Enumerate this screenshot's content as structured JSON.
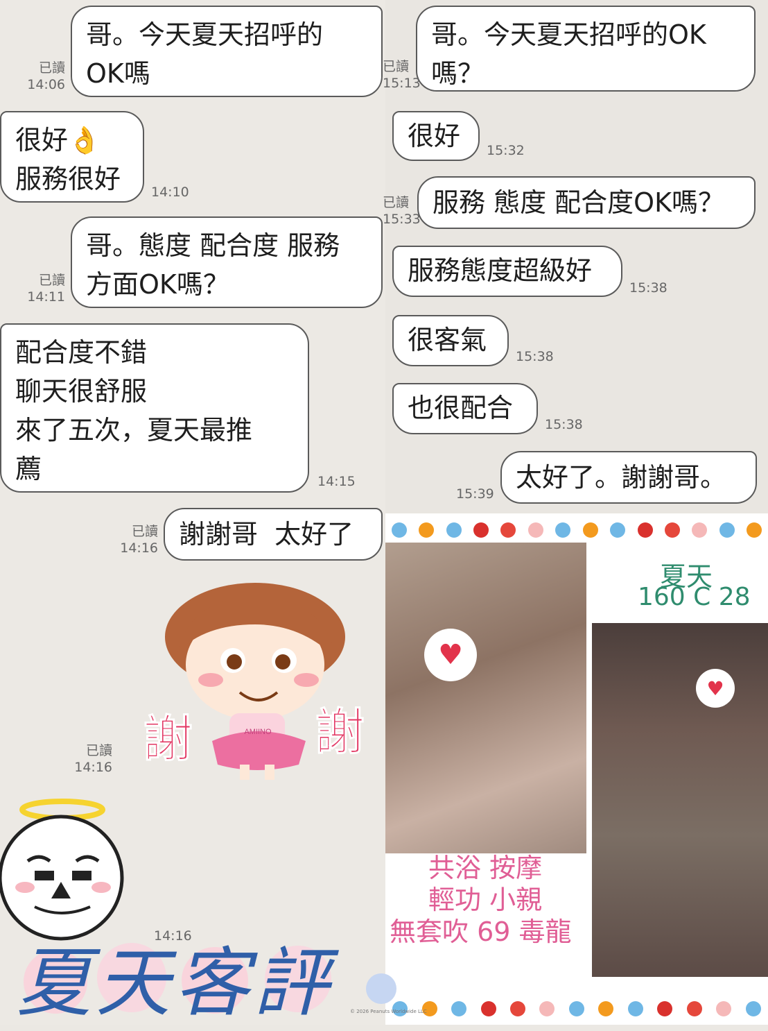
{
  "left_chat": {
    "messages": [
      {
        "side": "me",
        "text": "哥。今天夏天招呼的\nOK嗎",
        "read": "已讀",
        "time": "14:06"
      },
      {
        "side": "peer",
        "text": "很好👌\n服務很好",
        "time": "14:10"
      },
      {
        "side": "me",
        "text": "哥。態度 配合度 服務\n方面OK嗎？",
        "read": "已讀",
        "time": "14:11"
      },
      {
        "side": "peer",
        "text": "配合度不錯\n聊天很舒服\n來了五次，夏天最推\n薦",
        "time": "14:15"
      },
      {
        "side": "me",
        "text": "謝謝哥  太好了",
        "read": "已讀",
        "time": "14:16"
      }
    ],
    "sticker_girl": {
      "read": "已讀",
      "time": "14:16",
      "sign_left": "謝",
      "sign_right": "謝",
      "shirt_text": "AMIINO"
    },
    "sticker_angel": {
      "time": "14:16"
    }
  },
  "right_chat": {
    "messages": [
      {
        "side": "me",
        "text": "哥。今天夏天招呼的OK\n嗎？",
        "read": "已讀",
        "time": "15:13"
      },
      {
        "side": "peer",
        "text": "很好",
        "time": "15:32"
      },
      {
        "side": "me",
        "text": "服務 態度 配合度OK嗎？",
        "read": "已讀",
        "time": "15:33"
      },
      {
        "side": "peer",
        "text": "服務態度超級好",
        "time": "15:38"
      },
      {
        "side": "peer",
        "text": "很客氣",
        "time": "15:38"
      },
      {
        "side": "peer",
        "text": "也很配合",
        "time": "15:38"
      },
      {
        "side": "me",
        "text": "太好了。謝謝哥。",
        "time": "15:39"
      }
    ]
  },
  "promo": {
    "name": "夏天",
    "stats": "160 C 28",
    "services": [
      "共浴 按摩",
      "輕功 小親",
      "無套吹 69 毒龍"
    ],
    "heart": "♥"
  },
  "banner": {
    "title": "夏天客評",
    "copyright": "© 2026 Peanuts Worldwide LLC"
  },
  "colors": {
    "bubble_border": "#5a5a5a",
    "name_green": "#2f8c6e",
    "service_pink": "#e05e95",
    "title_blue": "#2f5fa8"
  }
}
